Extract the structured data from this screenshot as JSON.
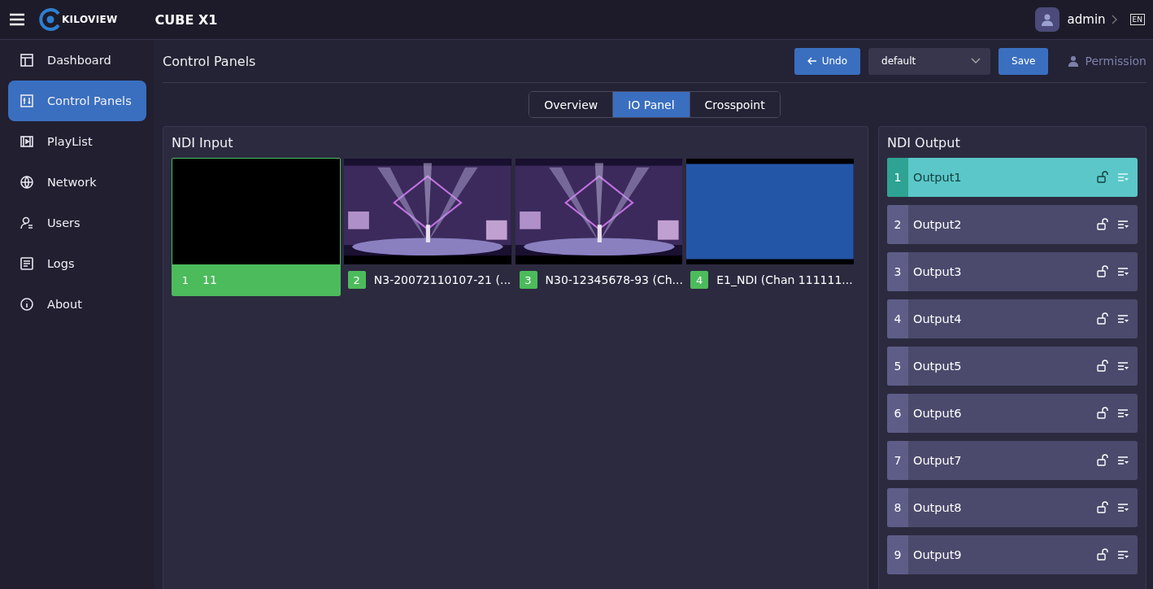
{
  "header": {
    "brand": "KILOVIEW",
    "product": "CUBE X1",
    "user": "admin",
    "language": "EN"
  },
  "sidebar": {
    "items": [
      {
        "label": "Dashboard",
        "selected": false
      },
      {
        "label": "Control Panels",
        "selected": true
      },
      {
        "label": "PlayList",
        "selected": false
      },
      {
        "label": "Network",
        "selected": false
      },
      {
        "label": "Users",
        "selected": false
      },
      {
        "label": "Logs",
        "selected": false
      },
      {
        "label": "About",
        "selected": false
      }
    ]
  },
  "page": {
    "title": "Control Panels",
    "undo": "Undo",
    "preset": "default",
    "save": "Save",
    "permission": "Permission"
  },
  "tabs": [
    {
      "label": "Overview",
      "selected": false
    },
    {
      "label": "IO Panel",
      "selected": true
    },
    {
      "label": "Crosspoint",
      "selected": false
    }
  ],
  "ndi_input": {
    "title": "NDI Input",
    "sources": [
      {
        "number": "1",
        "name": "11",
        "kind": "black",
        "selected": true
      },
      {
        "number": "2",
        "name": "N3-20072110107-21 (...",
        "kind": "picture",
        "selected": false
      },
      {
        "number": "3",
        "name": "N30-12345678-93 (Ch...",
        "kind": "picture",
        "selected": false
      },
      {
        "number": "4",
        "name": "E1_NDI (Chan 111111...",
        "kind": "blue",
        "selected": false
      }
    ]
  },
  "ndi_output": {
    "title": "NDI Output",
    "outputs": [
      {
        "number": "1",
        "name": "Output1",
        "selected": true
      },
      {
        "number": "2",
        "name": "Output2",
        "selected": false
      },
      {
        "number": "3",
        "name": "Output3",
        "selected": false
      },
      {
        "number": "4",
        "name": "Output4",
        "selected": false
      },
      {
        "number": "5",
        "name": "Output5",
        "selected": false
      },
      {
        "number": "6",
        "name": "Output6",
        "selected": false
      },
      {
        "number": "7",
        "name": "Output7",
        "selected": false
      },
      {
        "number": "8",
        "name": "Output8",
        "selected": false
      },
      {
        "number": "9",
        "name": "Output9",
        "selected": false
      }
    ]
  }
}
